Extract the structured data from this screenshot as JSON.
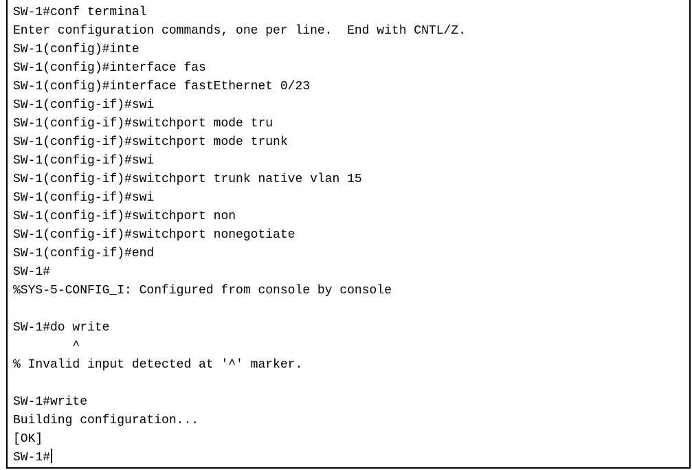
{
  "terminal": {
    "lines": [
      "SW-1#conf terminal",
      "Enter configuration commands, one per line.  End with CNTL/Z.",
      "SW-1(config)#inte",
      "SW-1(config)#interface fas",
      "SW-1(config)#interface fastEthernet 0/23",
      "SW-1(config-if)#swi",
      "SW-1(config-if)#switchport mode tru",
      "SW-1(config-if)#switchport mode trunk",
      "SW-1(config-if)#swi",
      "SW-1(config-if)#switchport trunk native vlan 15",
      "SW-1(config-if)#swi",
      "SW-1(config-if)#switchport non",
      "SW-1(config-if)#switchport nonegotiate",
      "SW-1(config-if)#end",
      "SW-1#",
      "%SYS-5-CONFIG_I: Configured from console by console",
      "",
      "SW-1#do write",
      "        ^",
      "% Invalid input detected at '^' marker.",
      "",
      "SW-1#write",
      "Building configuration...",
      "[OK]"
    ],
    "prompt": "SW-1#"
  }
}
